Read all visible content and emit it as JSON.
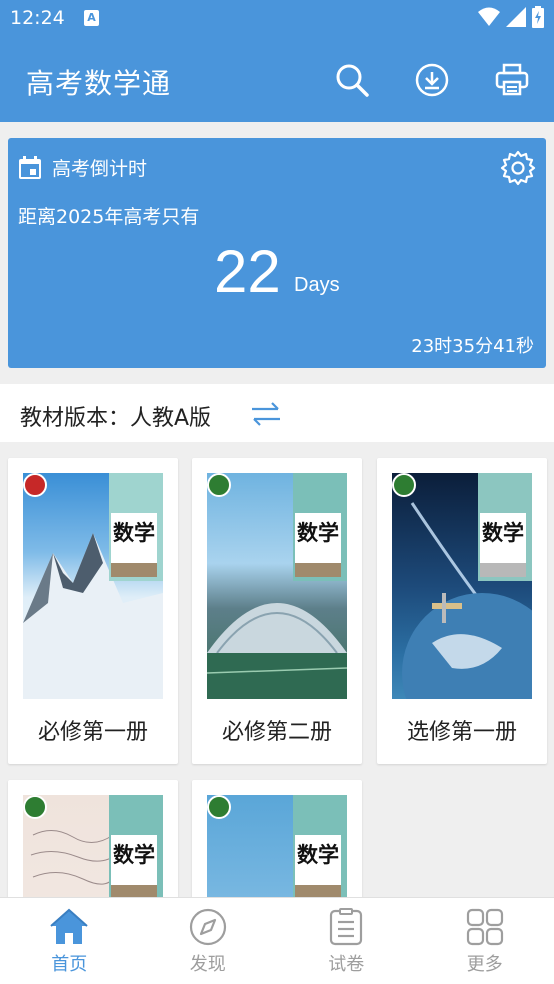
{
  "status": {
    "time": "12:24",
    "notification_letter": "A"
  },
  "app": {
    "title": "高考数学通"
  },
  "countdown": {
    "heading": "高考倒计时",
    "subtitle": "距离2025年高考只有",
    "days_number": "22",
    "days_unit": "Days",
    "remaining": "23时35分41秒"
  },
  "edition": {
    "label": "教材版本：人教A版"
  },
  "books": [
    {
      "label": "必修第一册",
      "cover_title": "数学"
    },
    {
      "label": "必修第二册",
      "cover_title": "数学"
    },
    {
      "label": "选修第一册",
      "cover_title": "数学"
    },
    {
      "label": "",
      "cover_title": "数学"
    },
    {
      "label": "",
      "cover_title": "数学"
    }
  ],
  "nav": [
    {
      "label": "首页",
      "icon": "home-icon",
      "active": true
    },
    {
      "label": "发现",
      "icon": "compass-icon",
      "active": false
    },
    {
      "label": "试卷",
      "icon": "paper-icon",
      "active": false
    },
    {
      "label": "更多",
      "icon": "grid-icon",
      "active": false
    }
  ],
  "colors": {
    "primary": "#4a95db",
    "background": "#efefef",
    "inactive": "#9e9e9e"
  }
}
